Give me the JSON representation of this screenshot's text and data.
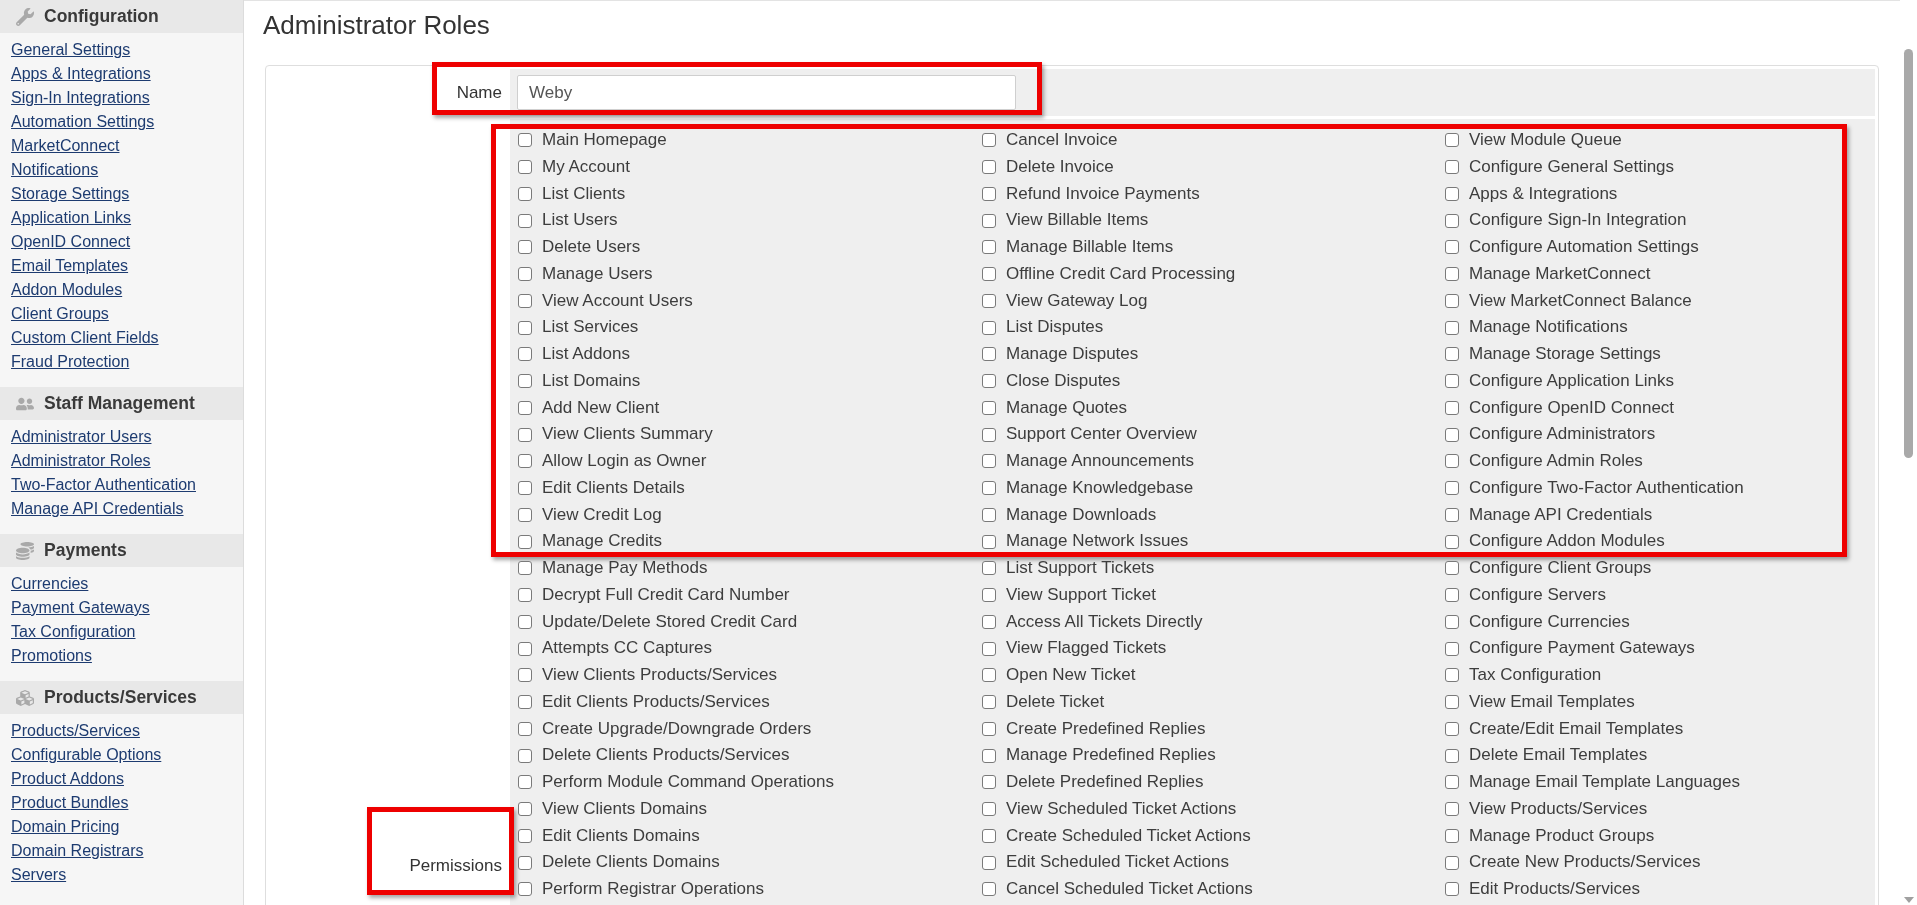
{
  "sidebar": {
    "sections": [
      {
        "title": "Configuration",
        "links": [
          "General Settings",
          "Apps & Integrations",
          "Sign-In Integrations",
          "Automation Settings",
          "MarketConnect",
          "Notifications",
          "Storage Settings",
          "Application Links",
          "OpenID Connect",
          "Email Templates",
          "Addon Modules",
          "Client Groups",
          "Custom Client Fields",
          "Fraud Protection"
        ]
      },
      {
        "title": "Staff Management",
        "links": [
          "Administrator Users",
          "Administrator Roles",
          "Two-Factor Authentication",
          "Manage API Credentials"
        ]
      },
      {
        "title": "Payments",
        "links": [
          "Currencies",
          "Payment Gateways",
          "Tax Configuration",
          "Promotions"
        ]
      },
      {
        "title": "Products/Services",
        "links": [
          "Products/Services",
          "Configurable Options",
          "Product Addons",
          "Product Bundles",
          "Domain Pricing",
          "Domain Registrars",
          "Servers"
        ]
      }
    ]
  },
  "page": {
    "title": "Administrator Roles"
  },
  "form": {
    "name": {
      "label": "Name",
      "value": "Weby",
      "highlighted": true
    },
    "permissions": {
      "label": "Permissions",
      "label_highlighted": true,
      "blocks": [
        {
          "highlighted": true,
          "rows": [
            [
              {
                "label": "Main Homepage",
                "checked": false
              },
              {
                "label": "Cancel Invoice",
                "checked": false
              },
              {
                "label": "View Module Queue",
                "checked": false
              }
            ],
            [
              {
                "label": "My Account",
                "checked": false
              },
              {
                "label": "Delete Invoice",
                "checked": false
              },
              {
                "label": "Configure General Settings",
                "checked": false
              }
            ],
            [
              {
                "label": "List Clients",
                "checked": false
              },
              {
                "label": "Refund Invoice Payments",
                "checked": false
              },
              {
                "label": "Apps & Integrations",
                "checked": false
              }
            ],
            [
              {
                "label": "List Users",
                "checked": false
              },
              {
                "label": "View Billable Items",
                "checked": false
              },
              {
                "label": "Configure Sign-In Integration",
                "checked": false
              }
            ],
            [
              {
                "label": "Delete Users",
                "checked": false
              },
              {
                "label": "Manage Billable Items",
                "checked": false
              },
              {
                "label": "Configure Automation Settings",
                "checked": false
              }
            ],
            [
              {
                "label": "Manage Users",
                "checked": false
              },
              {
                "label": "Offline Credit Card Processing",
                "checked": false
              },
              {
                "label": "Manage MarketConnect",
                "checked": false
              }
            ],
            [
              {
                "label": "View Account Users",
                "checked": false
              },
              {
                "label": "View Gateway Log",
                "checked": false
              },
              {
                "label": "View MarketConnect Balance",
                "checked": false
              }
            ],
            [
              {
                "label": "List Services",
                "checked": false
              },
              {
                "label": "List Disputes",
                "checked": false
              },
              {
                "label": "Manage Notifications",
                "checked": false
              }
            ],
            [
              {
                "label": "List Addons",
                "checked": false
              },
              {
                "label": "Manage Disputes",
                "checked": false
              },
              {
                "label": "Manage Storage Settings",
                "checked": false
              }
            ],
            [
              {
                "label": "List Domains",
                "checked": false
              },
              {
                "label": "Close Disputes",
                "checked": false
              },
              {
                "label": "Configure Application Links",
                "checked": false
              }
            ],
            [
              {
                "label": "Add New Client",
                "checked": false
              },
              {
                "label": "Manage Quotes",
                "checked": false
              },
              {
                "label": "Configure OpenID Connect",
                "checked": false
              }
            ],
            [
              {
                "label": "View Clients Summary",
                "checked": false
              },
              {
                "label": "Support Center Overview",
                "checked": false
              },
              {
                "label": "Configure Administrators",
                "checked": false
              }
            ],
            [
              {
                "label": "Allow Login as Owner",
                "checked": false
              },
              {
                "label": "Manage Announcements",
                "checked": false
              },
              {
                "label": "Configure Admin Roles",
                "checked": false
              }
            ],
            [
              {
                "label": "Edit Clients Details",
                "checked": false
              },
              {
                "label": "Manage Knowledgebase",
                "checked": false
              },
              {
                "label": "Configure Two-Factor Authentication",
                "checked": false
              }
            ],
            [
              {
                "label": "View Credit Log",
                "checked": false
              },
              {
                "label": "Manage Downloads",
                "checked": false
              },
              {
                "label": "Manage API Credentials",
                "checked": false
              }
            ],
            [
              {
                "label": "Manage Credits",
                "checked": false
              },
              {
                "label": "Manage Network Issues",
                "checked": false
              },
              {
                "label": "Configure Addon Modules",
                "checked": false
              }
            ]
          ]
        },
        {
          "highlighted": false,
          "rows": [
            [
              {
                "label": "Manage Pay Methods",
                "checked": false
              },
              {
                "label": "List Support Tickets",
                "checked": false
              },
              {
                "label": "Configure Client Groups",
                "checked": false
              }
            ],
            [
              {
                "label": "Decrypt Full Credit Card Number",
                "checked": false
              },
              {
                "label": "View Support Ticket",
                "checked": false
              },
              {
                "label": "Configure Servers",
                "checked": false
              }
            ],
            [
              {
                "label": "Update/Delete Stored Credit Card",
                "checked": false
              },
              {
                "label": "Access All Tickets Directly",
                "checked": false
              },
              {
                "label": "Configure Currencies",
                "checked": false
              }
            ],
            [
              {
                "label": "Attempts CC Captures",
                "checked": false
              },
              {
                "label": "View Flagged Tickets",
                "checked": false
              },
              {
                "label": "Configure Payment Gateways",
                "checked": false
              }
            ],
            [
              {
                "label": "View Clients Products/Services",
                "checked": false
              },
              {
                "label": "Open New Ticket",
                "checked": false
              },
              {
                "label": "Tax Configuration",
                "checked": false
              }
            ],
            [
              {
                "label": "Edit Clients Products/Services",
                "checked": false
              },
              {
                "label": "Delete Ticket",
                "checked": false
              },
              {
                "label": "View Email Templates",
                "checked": false
              }
            ],
            [
              {
                "label": "Create Upgrade/Downgrade Orders",
                "checked": false
              },
              {
                "label": "Create Predefined Replies",
                "checked": false
              },
              {
                "label": "Create/Edit Email Templates",
                "checked": false
              }
            ],
            [
              {
                "label": "Delete Clients Products/Services",
                "checked": false
              },
              {
                "label": "Manage Predefined Replies",
                "checked": false
              },
              {
                "label": "Delete Email Templates",
                "checked": false
              }
            ],
            [
              {
                "label": "Perform Module Command Operations",
                "checked": false
              },
              {
                "label": "Delete Predefined Replies",
                "checked": false
              },
              {
                "label": "Manage Email Template Languages",
                "checked": false
              }
            ],
            [
              {
                "label": "View Clients Domains",
                "checked": false
              },
              {
                "label": "View Scheduled Ticket Actions",
                "checked": false
              },
              {
                "label": "View Products/Services",
                "checked": false
              }
            ],
            [
              {
                "label": "Edit Clients Domains",
                "checked": false
              },
              {
                "label": "Create Scheduled Ticket Actions",
                "checked": false
              },
              {
                "label": "Manage Product Groups",
                "checked": false
              }
            ],
            [
              {
                "label": "Delete Clients Domains",
                "checked": false
              },
              {
                "label": "Edit Scheduled Ticket Actions",
                "checked": false
              },
              {
                "label": "Create New Products/Services",
                "checked": false
              }
            ],
            [
              {
                "label": "Perform Registrar Operations",
                "checked": false
              },
              {
                "label": "Cancel Scheduled Ticket Actions",
                "checked": false
              },
              {
                "label": "Edit Products/Services",
                "checked": false
              }
            ]
          ]
        }
      ]
    }
  }
}
